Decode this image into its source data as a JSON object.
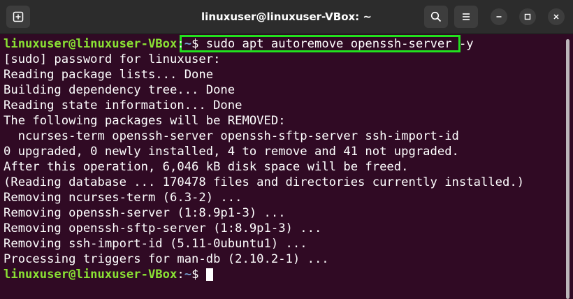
{
  "window": {
    "title": "linuxuser@linuxuser-VBox: ~"
  },
  "prompt": {
    "user": "linuxuser@linuxuser-VBox",
    "sep": ":",
    "path": "~",
    "dollar": "$"
  },
  "command": " sudo apt autoremove openssh-server -y",
  "output": [
    "[sudo] password for linuxuser:",
    "Reading package lists... Done",
    "Building dependency tree... Done",
    "Reading state information... Done",
    "The following packages will be REMOVED:",
    "  ncurses-term openssh-server openssh-sftp-server ssh-import-id",
    "0 upgraded, 0 newly installed, 4 to remove and 41 not upgraded.",
    "After this operation, 6,046 kB disk space will be freed.",
    "(Reading database ... 170478 files and directories currently installed.)",
    "Removing ncurses-term (6.3-2) ...",
    "Removing openssh-server (1:8.9p1-3) ...",
    "Removing openssh-sftp-server (1:8.9p1-3) ...",
    "Removing ssh-import-id (5.11-0ubuntu1) ...",
    "Processing triggers for man-db (2.10.2-1) ..."
  ],
  "colors": {
    "background": "#300a24",
    "prompt_user": "#8ae234",
    "prompt_path": "#729fcf",
    "highlight": "#22e01f",
    "titlebar": "#2c2c2c"
  },
  "icons": {
    "new_tab": "new-tab-icon",
    "search": "search-icon",
    "menu": "hamburger-menu-icon",
    "minimize": "minimize-icon",
    "maximize": "maximize-icon",
    "close": "close-icon"
  }
}
